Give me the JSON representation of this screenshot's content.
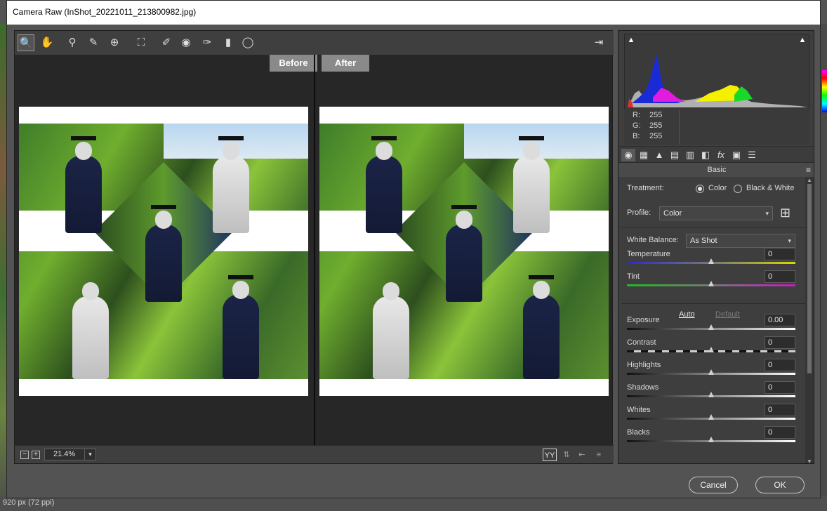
{
  "window": {
    "title": "Camera Raw (InShot_20221011_213800982.jpg)"
  },
  "toolbar": {
    "tools": [
      {
        "name": "zoom-icon",
        "glyph": "🔍"
      },
      {
        "name": "hand-icon",
        "glyph": "✋"
      },
      {
        "name": "white-balance-icon",
        "glyph": "⚲"
      },
      {
        "name": "color-sampler-icon",
        "glyph": "✎"
      },
      {
        "name": "targeted-adjustment-icon",
        "glyph": "⊕"
      },
      {
        "name": "crop-icon",
        "glyph": "⛶"
      },
      {
        "name": "spot-removal-icon",
        "glyph": "✐"
      },
      {
        "name": "red-eye-icon",
        "glyph": "◉"
      },
      {
        "name": "adjustment-brush-icon",
        "glyph": "✑"
      },
      {
        "name": "graduated-filter-icon",
        "glyph": "▮"
      },
      {
        "name": "radial-filter-icon",
        "glyph": "◯"
      }
    ],
    "exit_glyph": "⇥"
  },
  "preview": {
    "before_label": "Before",
    "after_label": "After",
    "zoom_value": "21.4%",
    "zoom_out_glyph": "−",
    "zoom_in_glyph": "+",
    "dropdown_glyph": "▾",
    "view_buttons": [
      "YY",
      "⇅",
      "⇤",
      "≡"
    ]
  },
  "histogram": {
    "clip_shadow_glyph": "▲",
    "clip_highlight_glyph": "▲",
    "r_label": "R:",
    "r_value": "255",
    "g_label": "G:",
    "g_value": "255",
    "b_label": "B:",
    "b_value": "255"
  },
  "panel_tabs": [
    "◉",
    "▦",
    "▲",
    "▤",
    "▥",
    "◧",
    "fx",
    "▣",
    "☰"
  ],
  "basic": {
    "header": "Basic",
    "menu_glyph": "≡",
    "treatment_label": "Treatment:",
    "treatment_color": "Color",
    "treatment_bw": "Black & White",
    "profile_label": "Profile:",
    "profile_value": "Color",
    "profile_browse_glyph": "⊞",
    "wb_label": "White Balance:",
    "wb_value": "As Shot",
    "auto_label": "Auto",
    "default_label": "Default",
    "sliders": [
      {
        "label": "Temperature",
        "value": "0",
        "level": 0.5
      },
      {
        "label": "Tint",
        "value": "0",
        "level": 0.5
      },
      {
        "label": "Exposure",
        "value": "0.00",
        "level": 0.5
      },
      {
        "label": "Contrast",
        "value": "0",
        "level": 0.5
      },
      {
        "label": "Highlights",
        "value": "0",
        "level": 0.5
      },
      {
        "label": "Shadows",
        "value": "0",
        "level": 0.5
      },
      {
        "label": "Whites",
        "value": "0",
        "level": 0.5
      },
      {
        "label": "Blacks",
        "value": "0",
        "level": 0.5
      }
    ]
  },
  "buttons": {
    "cancel": "Cancel",
    "ok": "OK"
  },
  "background": {
    "status_text": "920 px (72 ppi)"
  },
  "colors": {
    "accent": "#535353",
    "panel": "#3e3e3e",
    "preview_bg": "#272727"
  }
}
